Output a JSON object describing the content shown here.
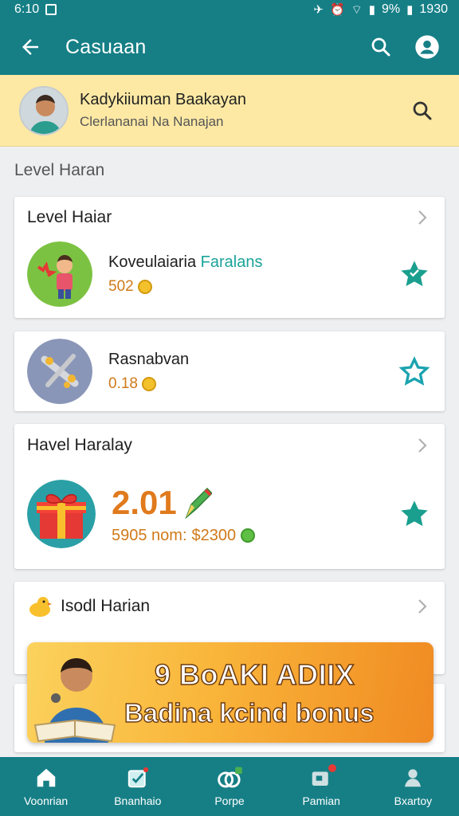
{
  "status": {
    "time": "6:10",
    "battery": "9%",
    "clock": "1930"
  },
  "appbar": {
    "title": "Casuaan"
  },
  "profile": {
    "name": "Kadykiiuman Baakayan",
    "subtitle": "Clerlananai Na Nanajan"
  },
  "section_title": "Level Haran",
  "card1": {
    "header": "Level Haiar",
    "item_title_a": "Koveulaiaria ",
    "item_title_b": "Faralans",
    "item_value": "502"
  },
  "card2": {
    "item_title": "Rasnabvan",
    "item_value": "0.18"
  },
  "card3": {
    "header": "Havel Haralay",
    "big_value": "2.01",
    "sub_value_a": "5905 nom:",
    "sub_value_b": "$2300"
  },
  "card4": {
    "header": "Isodl Harian"
  },
  "bonus": {
    "title": "9 BoAKI ADIIX",
    "subtitle": "Badina kcind bonus"
  },
  "nav": [
    {
      "label": "Voonrian",
      "icon": "home-icon"
    },
    {
      "label": "Bnanhaio",
      "icon": "tasks-icon"
    },
    {
      "label": "Porpe",
      "icon": "rings-icon"
    },
    {
      "label": "Pamian",
      "icon": "messages-icon"
    },
    {
      "label": "Bxartoy",
      "icon": "profile-icon"
    }
  ],
  "colors": {
    "primary": "#167f86",
    "banner": "#fde9a4",
    "accent": "#1aa39a",
    "value": "#e07a1c",
    "star": "#1a9f8f"
  }
}
